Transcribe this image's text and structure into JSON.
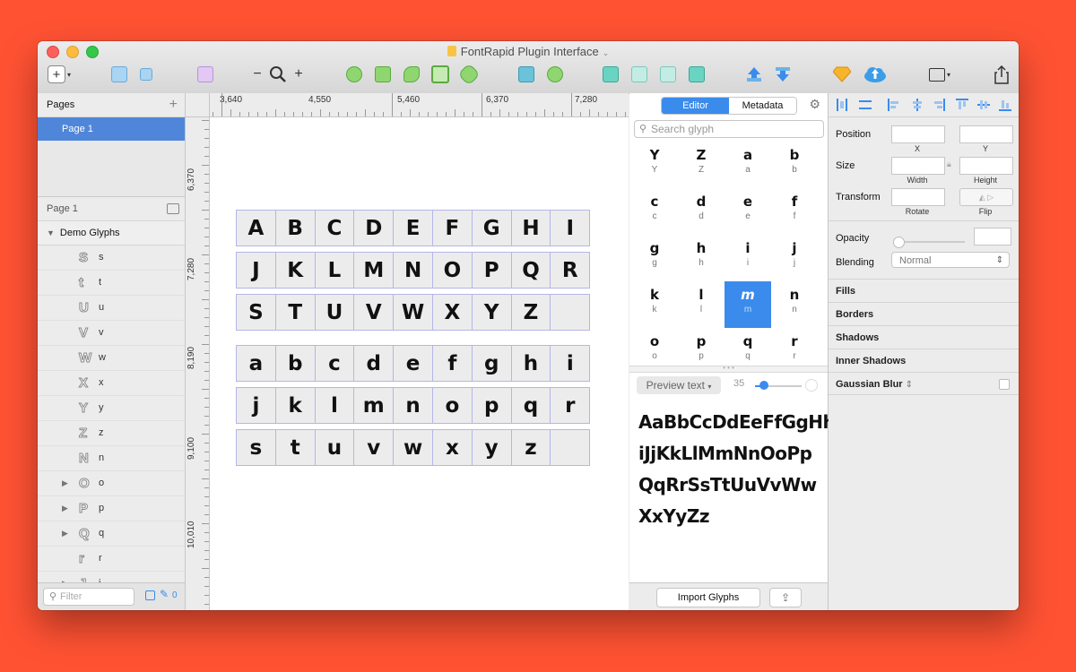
{
  "window": {
    "title": "FontRapid Plugin Interface"
  },
  "toolbar": {
    "zoom_minus": "−",
    "zoom_plus": "+",
    "insert_plus": "+"
  },
  "sidebar": {
    "pages_header": "Pages",
    "selected_page": "Page 1",
    "page_row": "Page 1",
    "group": "Demo Glyphs",
    "layers": [
      {
        "glyph": "S",
        "name": "s",
        "expandable": false
      },
      {
        "glyph": "t",
        "name": "t",
        "expandable": false
      },
      {
        "glyph": "U",
        "name": "u",
        "expandable": false
      },
      {
        "glyph": "V",
        "name": "v",
        "expandable": false
      },
      {
        "glyph": "W",
        "name": "w",
        "expandable": false
      },
      {
        "glyph": "X",
        "name": "x",
        "expandable": false
      },
      {
        "glyph": "Y",
        "name": "y",
        "expandable": false
      },
      {
        "glyph": "Z",
        "name": "z",
        "expandable": false
      },
      {
        "glyph": "N",
        "name": "n",
        "expandable": false
      },
      {
        "glyph": "O",
        "name": "o",
        "expandable": true
      },
      {
        "glyph": "P",
        "name": "p",
        "expandable": true
      },
      {
        "glyph": "Q",
        "name": "q",
        "expandable": true
      },
      {
        "glyph": "r",
        "name": "r",
        "expandable": false
      },
      {
        "glyph": "J",
        "name": "j",
        "expandable": true
      }
    ],
    "filter_placeholder": "Filter",
    "filter_count": "0"
  },
  "rulers": {
    "top": [
      "3,640",
      "4,550",
      "5,460",
      "6,370",
      "7,280"
    ],
    "left": [
      "6,370",
      "7,280",
      "8,190",
      "9,100",
      "10,010"
    ]
  },
  "canvas": {
    "upper_rows": [
      [
        "A",
        "B",
        "C",
        "D",
        "E",
        "F",
        "G",
        "H",
        "I"
      ],
      [
        "J",
        "K",
        "L",
        "M",
        "N",
        "O",
        "P",
        "Q",
        "R"
      ],
      [
        "S",
        "T",
        "U",
        "V",
        "W",
        "X",
        "Y",
        "Z",
        ""
      ]
    ],
    "lower_rows": [
      [
        "a",
        "b",
        "c",
        "d",
        "e",
        "f",
        "g",
        "h",
        "i"
      ],
      [
        "j",
        "k",
        "l",
        "m",
        "n",
        "o",
        "p",
        "q",
        "r"
      ],
      [
        "s",
        "t",
        "u",
        "v",
        "w",
        "x",
        "y",
        "z",
        ""
      ]
    ]
  },
  "glyph_panel": {
    "tab_editor": "Editor",
    "tab_metadata": "Metadata",
    "search_placeholder": "Search glyph",
    "glyphs": [
      {
        "g": "Y",
        "l": "Y"
      },
      {
        "g": "Z",
        "l": "Z"
      },
      {
        "g": "a",
        "l": "a"
      },
      {
        "g": "b",
        "l": "b"
      },
      {
        "g": "c",
        "l": "c"
      },
      {
        "g": "d",
        "l": "d"
      },
      {
        "g": "e",
        "l": "e"
      },
      {
        "g": "f",
        "l": "f"
      },
      {
        "g": "g",
        "l": "g"
      },
      {
        "g": "h",
        "l": "h"
      },
      {
        "g": "i",
        "l": "i"
      },
      {
        "g": "j",
        "l": "j"
      },
      {
        "g": "k",
        "l": "k"
      },
      {
        "g": "l",
        "l": "l"
      },
      {
        "g": "m",
        "l": "m",
        "selected": true
      },
      {
        "g": "n",
        "l": "n"
      },
      {
        "g": "o",
        "l": "o"
      },
      {
        "g": "p",
        "l": "p"
      },
      {
        "g": "q",
        "l": "q"
      },
      {
        "g": "r",
        "l": "r"
      }
    ],
    "preview_button": "Preview text",
    "preview_size": "35",
    "preview_size_fraction": 0.1,
    "preview_lines": [
      "AaBbCcDdEeFfGgHhI",
      "iJjKkLlMmNnOoPp",
      "QqRrSsTtUuVvWw",
      "XxYyZz"
    ],
    "import_button": "Import Glyphs"
  },
  "inspector": {
    "position": "Position",
    "x": "X",
    "y": "Y",
    "size": "Size",
    "width": "Width",
    "height": "Height",
    "transform": "Transform",
    "rotate": "Rotate",
    "flip": "Flip",
    "opacity": "Opacity",
    "opacity_value": 0,
    "blending": "Blending",
    "blending_value": "Normal",
    "fills": "Fills",
    "borders": "Borders",
    "shadows": "Shadows",
    "inner_shadows": "Inner Shadows",
    "gaussian_blur": "Gaussian Blur"
  },
  "colors": {
    "accent": "#3b8bec",
    "selection": "#4f86d9",
    "background": "#ff5233"
  }
}
